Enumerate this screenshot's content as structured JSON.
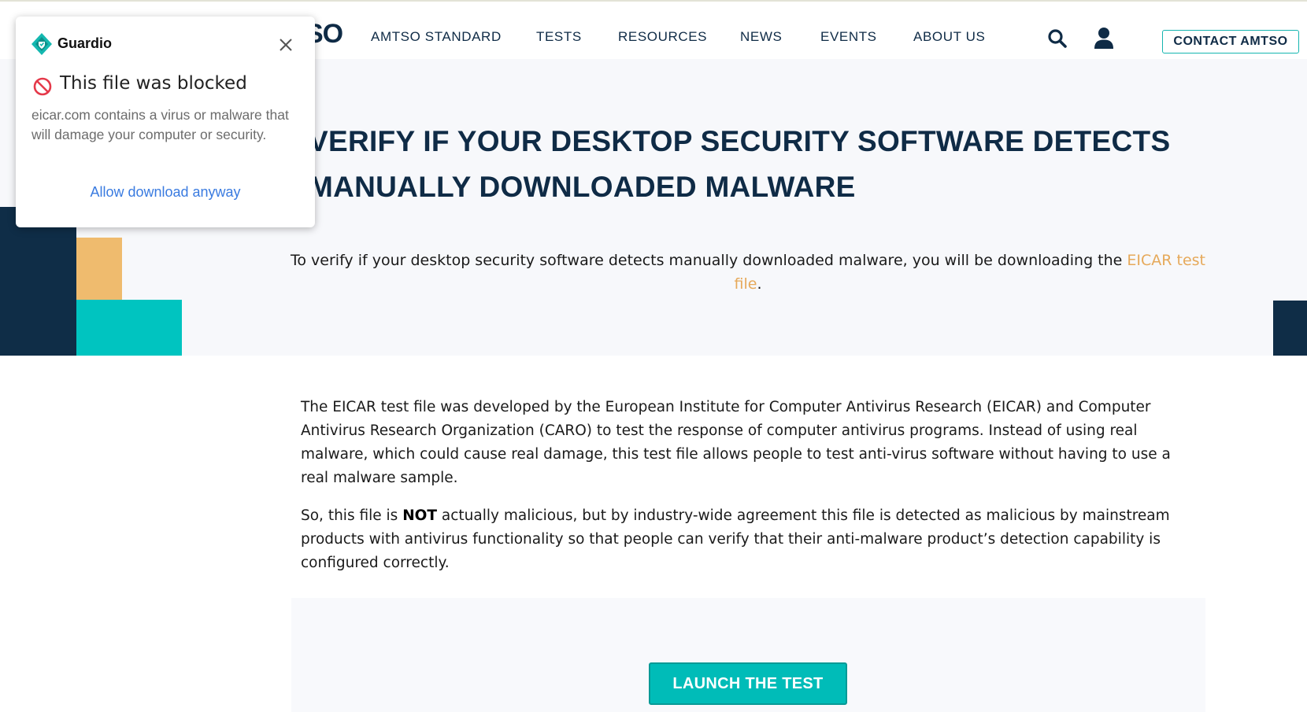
{
  "header": {
    "logo_partial": "SO",
    "nav": [
      "AMTSO STANDARD",
      "TESTS",
      "RESOURCES",
      "NEWS",
      "EVENTS",
      "ABOUT US"
    ],
    "search_icon": "search-icon",
    "account_icon": "user-icon",
    "contact_label": "CONTACT AMTSO"
  },
  "hero": {
    "title_line1": "VERIFY IF YOUR DESKTOP SECURITY SOFTWARE DETECTS",
    "title_line2": "MANUALLY DOWNLOADED MALWARE",
    "subtitle_prefix": "To verify if your desktop security software detects manually downloaded malware, you will be downloading the ",
    "subtitle_link": "EICAR test file",
    "subtitle_suffix": "."
  },
  "body": {
    "para1": "The EICAR test file was developed by the European Institute for Computer Antivirus Research (EICAR) and Computer Antivirus Research Organization (CARO) to test the response of computer antivirus programs. Instead of using real malware, which could cause real damage, this test file allows people to test anti-virus software without having to use a real malware sample.",
    "para2_prefix": "So, this file is ",
    "para2_bold": "NOT",
    "para2_suffix": " actually malicious, but by industry-wide agreement this file is detected as malicious by mainstream products with antivirus functionality so that people can verify that their anti-malware product’s detection capability is configured correctly.",
    "launch_label": "LAUNCH THE TEST"
  },
  "popup": {
    "brand": "Guardio",
    "title": "This file was blocked",
    "message": "eicar.com contains a virus or malware that will damage your computer or security.",
    "allow_label": "Allow download anyway",
    "icons": [
      "guardio-logo-icon",
      "close-icon",
      "blocked-icon"
    ]
  },
  "colors": {
    "navy": "#0f2b46",
    "teal": "#00c4c0",
    "gold": "#efbb6e",
    "link_gold": "#e6a95a",
    "popup_link": "#3a7be0",
    "block_red": "#e5394a"
  }
}
